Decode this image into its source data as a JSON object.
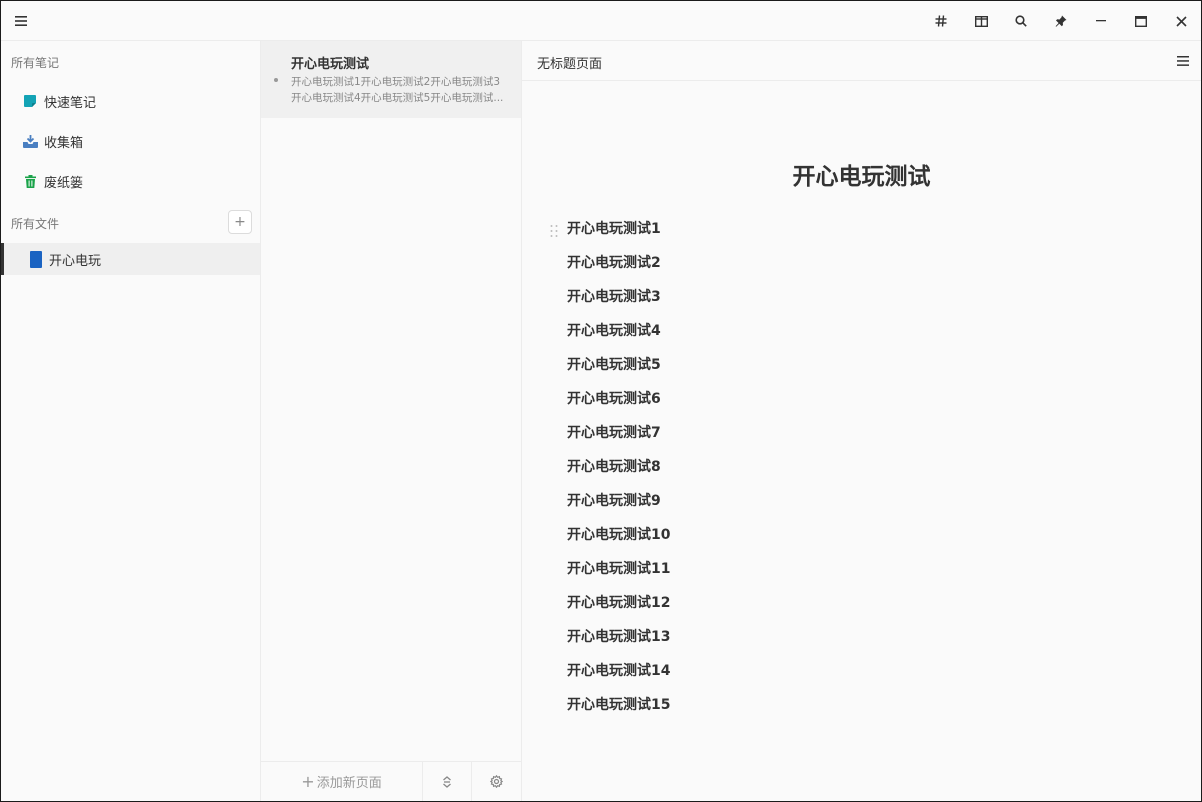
{
  "titlebar": {
    "icons": [
      "menu-icon",
      "hash-icon",
      "split-view-icon",
      "search-icon",
      "pin-icon",
      "minimize-icon",
      "maximize-icon",
      "close-icon"
    ]
  },
  "sidebar": {
    "notes_label": "所有笔记",
    "items": [
      {
        "label": "快速笔记",
        "icon": "quick-note-icon",
        "color": "#13a3b5"
      },
      {
        "label": "收集箱",
        "icon": "inbox-icon",
        "color": "#4a7fc1"
      },
      {
        "label": "废纸篓",
        "icon": "trash-icon",
        "color": "#1aa34a"
      }
    ],
    "files_label": "所有文件",
    "add_file": "+",
    "files": [
      {
        "label": "开心电玩",
        "color": "#1a63c2"
      }
    ]
  },
  "pages": {
    "items": [
      {
        "title": "开心电玩测试",
        "preview_line1": "开心电玩测试1开心电玩测试2开心电玩测试3",
        "preview_line2": "开心电玩测试4开心电玩测试5开心电玩测试..."
      }
    ],
    "add_page_label": "添加新页面",
    "add_page_plus": "+"
  },
  "editor": {
    "header_title": "无标题页面",
    "doc_title": "开心电玩测试",
    "blocks": [
      "开心电玩测试1",
      "开心电玩测试2",
      "开心电玩测试3",
      "开心电玩测试4",
      "开心电玩测试5",
      "开心电玩测试6",
      "开心电玩测试7",
      "开心电玩测试8",
      "开心电玩测试9",
      "开心电玩测试10",
      "开心电玩测试11",
      "开心电玩测试12",
      "开心电玩测试13",
      "开心电玩测试14",
      "开心电玩测试15"
    ]
  }
}
